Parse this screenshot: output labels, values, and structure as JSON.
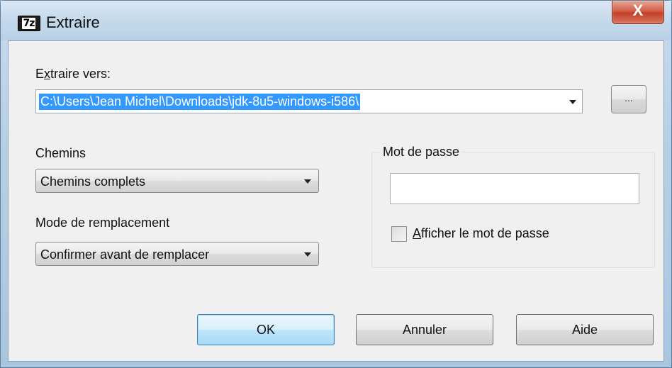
{
  "window": {
    "title": "Extraire",
    "app_icon_text": "7z",
    "close_label": "X"
  },
  "extract_to": {
    "label_prefix": "E",
    "label_underlined": "x",
    "label_suffix": "traire vers:",
    "path_value": "C:\\Users\\Jean Michel\\Downloads\\jdk-8u5-windows-i586\\",
    "browse_label": "..."
  },
  "paths": {
    "label": "Chemins",
    "selected": "Chemins complets"
  },
  "overwrite_mode": {
    "label": "Mode de remplacement",
    "selected": "Confirmer avant de remplacer"
  },
  "password": {
    "group_label": "Mot de passe",
    "value": "",
    "show_label_underlined": "A",
    "show_label_rest": "fficher le mot de passe",
    "show_checked": false
  },
  "buttons": {
    "ok": "OK",
    "cancel": "Annuler",
    "help": "Aide"
  },
  "colors": {
    "selection": "#3399ff",
    "default_button": "#bee6fd",
    "close_button": "#c2402a"
  }
}
